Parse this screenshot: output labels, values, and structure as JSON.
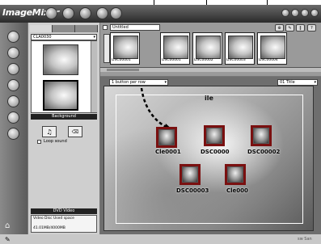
{
  "app": {
    "name": "ImageMixer"
  },
  "toolbar": {
    "icons": [
      "open-icon",
      "save-icon",
      "print-icon",
      "write-disc-icon"
    ],
    "right_icons": [
      "help-icon",
      "settings-icon",
      "minimize-icon",
      "close-icon"
    ]
  },
  "sidebar": {
    "icons": [
      "import-icon",
      "album-icon",
      "slideshow-icon",
      "label-icon",
      "video-icon",
      "dvd-icon",
      "home-icon"
    ]
  },
  "browser": {
    "folder_select": "CLA0030",
    "background_header": "Background",
    "loop_sound_label": "Loop sound",
    "dvd_header": "DVD Video",
    "disc_info_labels": "Video Disc   Used space",
    "disc_info_value": "41.01MB/4000MB"
  },
  "strip": {
    "title_value": "Untitled",
    "items": [
      {
        "caption": "DSC00001"
      },
      {
        "caption": "DSC00001"
      },
      {
        "caption": "DSC00002"
      },
      {
        "caption": "DSC00003"
      },
      {
        "caption": "DSC00004"
      }
    ]
  },
  "canvas": {
    "layout_select": "1 button per row",
    "title_select": "01 Title",
    "overlay_title": "ile",
    "buttons": [
      {
        "label": "Cle0001"
      },
      {
        "label": "DSC0000"
      },
      {
        "label": "DSC00002"
      },
      {
        "label": "DSC00003"
      },
      {
        "label": "Cle000"
      }
    ]
  },
  "status": {
    "brand": "sw San"
  },
  "colors": {
    "menu_button_border": "#7a1010",
    "dark_header": "#222222",
    "callout_arrow": "#000000"
  }
}
